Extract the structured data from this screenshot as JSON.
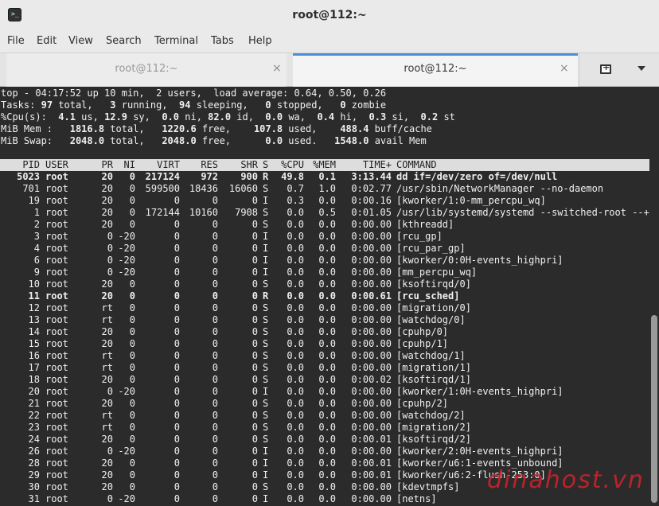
{
  "window": {
    "title": "root@112:~",
    "app_icon": "terminal-icon",
    "app_icon_glyph": ">_"
  },
  "menu": [
    "File",
    "Edit",
    "View",
    "Search",
    "Terminal",
    "Tabs",
    "Help"
  ],
  "tabs": [
    {
      "label": "root@112:~",
      "active": false,
      "close": "×"
    },
    {
      "label": "root@112:~",
      "active": true,
      "close": "×"
    }
  ],
  "tab_actions": {
    "new_tab_icon": "new-tab-icon",
    "new_tab_glyph": "+",
    "dropdown_icon": "chevron-down-icon"
  },
  "summary": {
    "line1": "top - 04:17:52 up 10 min,  2 users,  load average: 0.64, 0.50, 0.26",
    "line2": {
      "label": "Tasks:",
      "total": "97",
      "running": "3",
      "sleeping": "94",
      "stopped": "0",
      "zombie": "0"
    },
    "line3": {
      "label": "%Cpu(s):",
      "us": "4.1",
      "sy": "12.9",
      "ni": "0.0",
      "id": "82.0",
      "wa": "0.0",
      "hi": "0.4",
      "si": "0.3",
      "st": "0.2"
    },
    "line4": {
      "label": "MiB Mem :",
      "total": "1816.8",
      "free": "1220.6",
      "used": "107.8",
      "buff_cache": "488.4"
    },
    "line5": {
      "label": "MiB Swap:",
      "total": "2048.0",
      "free": "2048.0",
      "used": "0.0",
      "avail": "1548.0"
    }
  },
  "columns": [
    "PID",
    "USER",
    "PR",
    "NI",
    "VIRT",
    "RES",
    "SHR",
    "S",
    "%CPU",
    "%MEM",
    "TIME+",
    "COMMAND"
  ],
  "processes": [
    {
      "pid": "5023",
      "user": "root",
      "pr": "20",
      "ni": "0",
      "virt": "217124",
      "res": "972",
      "shr": "900",
      "s": "R",
      "cpu": "49.8",
      "mem": "0.1",
      "time": "3:13.44",
      "cmd": "dd if=/dev/zero of=/dev/null",
      "bold": true
    },
    {
      "pid": "701",
      "user": "root",
      "pr": "20",
      "ni": "0",
      "virt": "599500",
      "res": "18436",
      "shr": "16060",
      "s": "S",
      "cpu": "0.7",
      "mem": "1.0",
      "time": "0:02.77",
      "cmd": "/usr/sbin/NetworkManager --no-daemon",
      "bold": false
    },
    {
      "pid": "19",
      "user": "root",
      "pr": "20",
      "ni": "0",
      "virt": "0",
      "res": "0",
      "shr": "0",
      "s": "I",
      "cpu": "0.3",
      "mem": "0.0",
      "time": "0:00.16",
      "cmd": "[kworker/1:0-mm_percpu_wq]",
      "bold": false
    },
    {
      "pid": "1",
      "user": "root",
      "pr": "20",
      "ni": "0",
      "virt": "172144",
      "res": "10160",
      "shr": "7908",
      "s": "S",
      "cpu": "0.0",
      "mem": "0.5",
      "time": "0:01.05",
      "cmd": "/usr/lib/systemd/systemd --switched-root --+",
      "bold": false
    },
    {
      "pid": "2",
      "user": "root",
      "pr": "20",
      "ni": "0",
      "virt": "0",
      "res": "0",
      "shr": "0",
      "s": "S",
      "cpu": "0.0",
      "mem": "0.0",
      "time": "0:00.00",
      "cmd": "[kthreadd]",
      "bold": false
    },
    {
      "pid": "3",
      "user": "root",
      "pr": "0",
      "ni": "-20",
      "virt": "0",
      "res": "0",
      "shr": "0",
      "s": "I",
      "cpu": "0.0",
      "mem": "0.0",
      "time": "0:00.00",
      "cmd": "[rcu_gp]",
      "bold": false
    },
    {
      "pid": "4",
      "user": "root",
      "pr": "0",
      "ni": "-20",
      "virt": "0",
      "res": "0",
      "shr": "0",
      "s": "I",
      "cpu": "0.0",
      "mem": "0.0",
      "time": "0:00.00",
      "cmd": "[rcu_par_gp]",
      "bold": false
    },
    {
      "pid": "6",
      "user": "root",
      "pr": "0",
      "ni": "-20",
      "virt": "0",
      "res": "0",
      "shr": "0",
      "s": "I",
      "cpu": "0.0",
      "mem": "0.0",
      "time": "0:00.00",
      "cmd": "[kworker/0:0H-events_highpri]",
      "bold": false
    },
    {
      "pid": "9",
      "user": "root",
      "pr": "0",
      "ni": "-20",
      "virt": "0",
      "res": "0",
      "shr": "0",
      "s": "I",
      "cpu": "0.0",
      "mem": "0.0",
      "time": "0:00.00",
      "cmd": "[mm_percpu_wq]",
      "bold": false
    },
    {
      "pid": "10",
      "user": "root",
      "pr": "20",
      "ni": "0",
      "virt": "0",
      "res": "0",
      "shr": "0",
      "s": "S",
      "cpu": "0.0",
      "mem": "0.0",
      "time": "0:00.00",
      "cmd": "[ksoftirqd/0]",
      "bold": false
    },
    {
      "pid": "11",
      "user": "root",
      "pr": "20",
      "ni": "0",
      "virt": "0",
      "res": "0",
      "shr": "0",
      "s": "R",
      "cpu": "0.0",
      "mem": "0.0",
      "time": "0:00.61",
      "cmd": "[rcu_sched]",
      "bold": true
    },
    {
      "pid": "12",
      "user": "root",
      "pr": "rt",
      "ni": "0",
      "virt": "0",
      "res": "0",
      "shr": "0",
      "s": "S",
      "cpu": "0.0",
      "mem": "0.0",
      "time": "0:00.00",
      "cmd": "[migration/0]",
      "bold": false
    },
    {
      "pid": "13",
      "user": "root",
      "pr": "rt",
      "ni": "0",
      "virt": "0",
      "res": "0",
      "shr": "0",
      "s": "S",
      "cpu": "0.0",
      "mem": "0.0",
      "time": "0:00.00",
      "cmd": "[watchdog/0]",
      "bold": false
    },
    {
      "pid": "14",
      "user": "root",
      "pr": "20",
      "ni": "0",
      "virt": "0",
      "res": "0",
      "shr": "0",
      "s": "S",
      "cpu": "0.0",
      "mem": "0.0",
      "time": "0:00.00",
      "cmd": "[cpuhp/0]",
      "bold": false
    },
    {
      "pid": "15",
      "user": "root",
      "pr": "20",
      "ni": "0",
      "virt": "0",
      "res": "0",
      "shr": "0",
      "s": "S",
      "cpu": "0.0",
      "mem": "0.0",
      "time": "0:00.00",
      "cmd": "[cpuhp/1]",
      "bold": false
    },
    {
      "pid": "16",
      "user": "root",
      "pr": "rt",
      "ni": "0",
      "virt": "0",
      "res": "0",
      "shr": "0",
      "s": "S",
      "cpu": "0.0",
      "mem": "0.0",
      "time": "0:00.00",
      "cmd": "[watchdog/1]",
      "bold": false
    },
    {
      "pid": "17",
      "user": "root",
      "pr": "rt",
      "ni": "0",
      "virt": "0",
      "res": "0",
      "shr": "0",
      "s": "S",
      "cpu": "0.0",
      "mem": "0.0",
      "time": "0:00.00",
      "cmd": "[migration/1]",
      "bold": false
    },
    {
      "pid": "18",
      "user": "root",
      "pr": "20",
      "ni": "0",
      "virt": "0",
      "res": "0",
      "shr": "0",
      "s": "S",
      "cpu": "0.0",
      "mem": "0.0",
      "time": "0:00.02",
      "cmd": "[ksoftirqd/1]",
      "bold": false
    },
    {
      "pid": "20",
      "user": "root",
      "pr": "0",
      "ni": "-20",
      "virt": "0",
      "res": "0",
      "shr": "0",
      "s": "I",
      "cpu": "0.0",
      "mem": "0.0",
      "time": "0:00.00",
      "cmd": "[kworker/1:0H-events_highpri]",
      "bold": false
    },
    {
      "pid": "21",
      "user": "root",
      "pr": "20",
      "ni": "0",
      "virt": "0",
      "res": "0",
      "shr": "0",
      "s": "S",
      "cpu": "0.0",
      "mem": "0.0",
      "time": "0:00.00",
      "cmd": "[cpuhp/2]",
      "bold": false
    },
    {
      "pid": "22",
      "user": "root",
      "pr": "rt",
      "ni": "0",
      "virt": "0",
      "res": "0",
      "shr": "0",
      "s": "S",
      "cpu": "0.0",
      "mem": "0.0",
      "time": "0:00.00",
      "cmd": "[watchdog/2]",
      "bold": false
    },
    {
      "pid": "23",
      "user": "root",
      "pr": "rt",
      "ni": "0",
      "virt": "0",
      "res": "0",
      "shr": "0",
      "s": "S",
      "cpu": "0.0",
      "mem": "0.0",
      "time": "0:00.00",
      "cmd": "[migration/2]",
      "bold": false
    },
    {
      "pid": "24",
      "user": "root",
      "pr": "20",
      "ni": "0",
      "virt": "0",
      "res": "0",
      "shr": "0",
      "s": "S",
      "cpu": "0.0",
      "mem": "0.0",
      "time": "0:00.01",
      "cmd": "[ksoftirqd/2]",
      "bold": false
    },
    {
      "pid": "26",
      "user": "root",
      "pr": "0",
      "ni": "-20",
      "virt": "0",
      "res": "0",
      "shr": "0",
      "s": "I",
      "cpu": "0.0",
      "mem": "0.0",
      "time": "0:00.00",
      "cmd": "[kworker/2:0H-events_highpri]",
      "bold": false
    },
    {
      "pid": "28",
      "user": "root",
      "pr": "20",
      "ni": "0",
      "virt": "0",
      "res": "0",
      "shr": "0",
      "s": "I",
      "cpu": "0.0",
      "mem": "0.0",
      "time": "0:00.01",
      "cmd": "[kworker/u6:1-events_unbound]",
      "bold": false
    },
    {
      "pid": "29",
      "user": "root",
      "pr": "20",
      "ni": "0",
      "virt": "0",
      "res": "0",
      "shr": "0",
      "s": "I",
      "cpu": "0.0",
      "mem": "0.0",
      "time": "0:00.01",
      "cmd": "[kworker/u6:2-flush-253:0]",
      "bold": false
    },
    {
      "pid": "30",
      "user": "root",
      "pr": "20",
      "ni": "0",
      "virt": "0",
      "res": "0",
      "shr": "0",
      "s": "S",
      "cpu": "0.0",
      "mem": "0.0",
      "time": "0:00.00",
      "cmd": "[kdevtmpfs]",
      "bold": false
    },
    {
      "pid": "31",
      "user": "root",
      "pr": "0",
      "ni": "-20",
      "virt": "0",
      "res": "0",
      "shr": "0",
      "s": "I",
      "cpu": "0.0",
      "mem": "0.0",
      "time": "0:00.00",
      "cmd": "[netns]",
      "bold": false
    }
  ],
  "watermark": {
    "text": "dinahost.vn"
  },
  "colors": {
    "terminal_bg": "#2b2b2b",
    "terminal_fg": "#f0f0f0",
    "header_bg": "#dddddd",
    "active_tab_accent": "#4a90d9",
    "watermark": "#c9232c"
  }
}
